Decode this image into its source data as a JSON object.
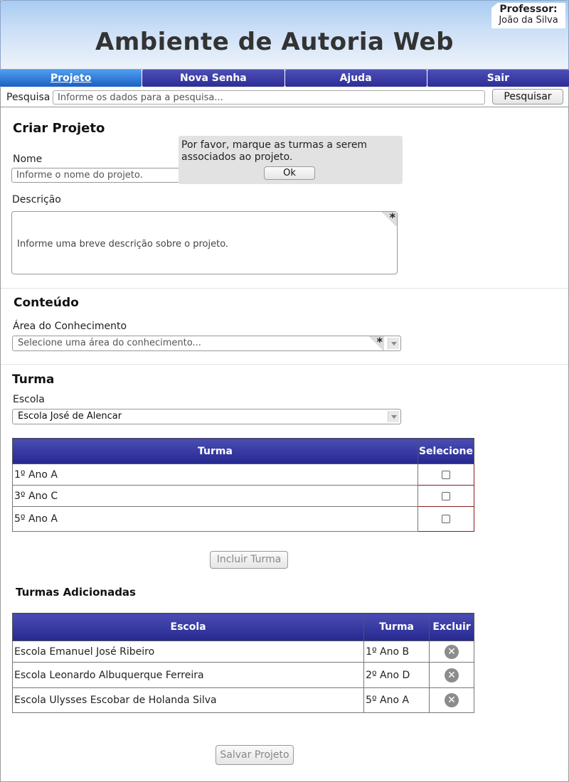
{
  "header": {
    "app_title": "Ambiente de Autoria Web",
    "professor_label": "Professor:",
    "professor_name": "João da Silva"
  },
  "nav": {
    "items": [
      {
        "label": "Projeto",
        "active": true
      },
      {
        "label": "Nova Senha",
        "active": false
      },
      {
        "label": "Ajuda",
        "active": false
      },
      {
        "label": "Sair",
        "active": false
      }
    ]
  },
  "search": {
    "label": "Pesquisa",
    "placeholder": "Informe os dados para a pesquisa...",
    "button": "Pesquisar"
  },
  "criar_projeto": {
    "title": "Criar Projeto",
    "nome_label": "Nome",
    "nome_placeholder": "Informe o nome do projeto.",
    "descricao_label": "Descrição",
    "descricao_placeholder": "Informe uma breve descrição sobre o projeto.",
    "required_mark": "*"
  },
  "dialog": {
    "message": "Por favor, marque as turmas a serem associados ao projeto.",
    "ok": "Ok"
  },
  "conteudo": {
    "title": "Conteúdo",
    "area_label": "Área do Conhecimento",
    "area_placeholder": "Selecione uma área do conhecimento...",
    "required_mark": "*"
  },
  "turma": {
    "title": "Turma",
    "escola_label": "Escola",
    "escola_selected": "Escola José de Alencar",
    "table": {
      "headers": [
        "Turma",
        "Selecione"
      ],
      "rows": [
        {
          "turma": "1º Ano A",
          "checked": false
        },
        {
          "turma": "3º Ano C",
          "checked": false
        },
        {
          "turma": "5º Ano A",
          "checked": false
        }
      ]
    },
    "incluir_button": "Incluir Turma"
  },
  "turmas_adicionadas": {
    "title": "Turmas Adicionadas",
    "headers": [
      "Escola",
      "Turma",
      "Excluir"
    ],
    "rows": [
      {
        "escola": "Escola Emanuel José Ribeiro",
        "turma": "1º Ano B"
      },
      {
        "escola": "Escola Leonardo Albuquerque Ferreira",
        "turma": "2º Ano D"
      },
      {
        "escola": "Escola Ulysses Escobar de Holanda Silva",
        "turma": "5º Ano A"
      }
    ],
    "delete_icon": "close-circle-icon"
  },
  "footer": {
    "salvar_button": "Salvar Projeto"
  }
}
